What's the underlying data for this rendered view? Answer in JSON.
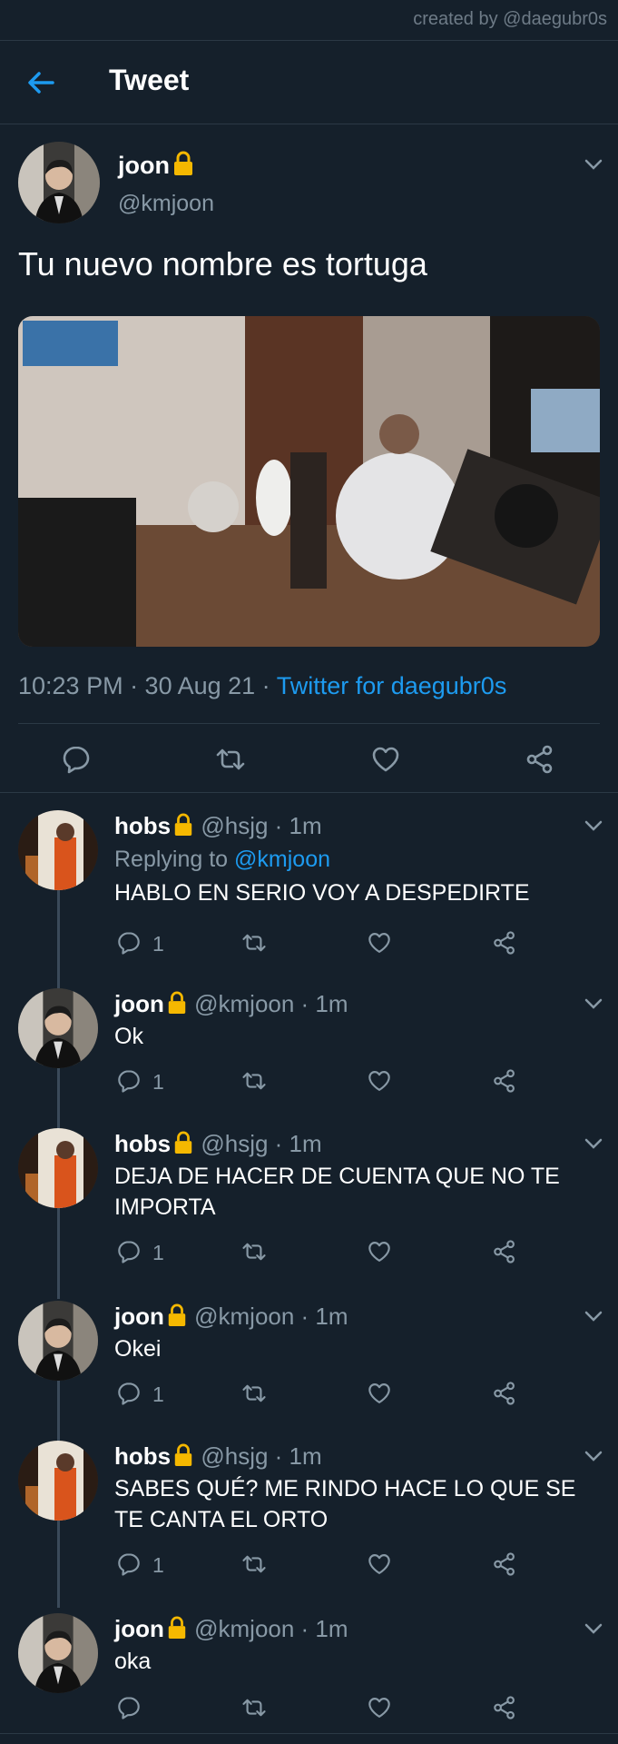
{
  "watermark": "created by @daegubr0s",
  "header": {
    "title": "Tweet"
  },
  "tweet": {
    "name": "joon",
    "handle": "@kmjoon",
    "text": "Tu nuevo nombre es tortuga",
    "time": "10:23 PM · 30 Aug 21 · ",
    "source": "Twitter for daegubr0s"
  },
  "replies": [
    {
      "name": "hobs",
      "handle": "@hsjg · 1m",
      "replying_prefix": "Replying to ",
      "replying_to": "@kmjoon",
      "text": "HABLO EN SERIO VOY A DESPEDIRTE",
      "replies": "1"
    },
    {
      "name": "joon",
      "handle": "@kmjoon · 1m",
      "text": "Ok",
      "replies": "1"
    },
    {
      "name": "hobs",
      "handle": "@hsjg · 1m",
      "text": "DEJA DE HACER DE CUENTA QUE NO TE IMPORTA",
      "replies": "1"
    },
    {
      "name": "joon",
      "handle": "@kmjoon · 1m",
      "text": "Okei",
      "replies": "1"
    },
    {
      "name": "hobs",
      "handle": "@hsjg · 1m",
      "text": "SABES QUÉ? ME RINDO HACE LO QUE SE TE CANTA EL ORTO",
      "replies": "1"
    },
    {
      "name": "joon",
      "handle": "@kmjoon · 1m",
      "text": "oka",
      "replies": ""
    }
  ],
  "icons": [
    "back-arrow-icon",
    "lock-icon",
    "chevron-down-icon",
    "reply-icon",
    "retweet-icon",
    "like-icon",
    "share-icon"
  ],
  "colors": {
    "background": "#15202b",
    "accent": "#1d9bf0",
    "secondary_text": "#8899a6",
    "divider": "#2b3945",
    "lock": "#f5b800"
  }
}
